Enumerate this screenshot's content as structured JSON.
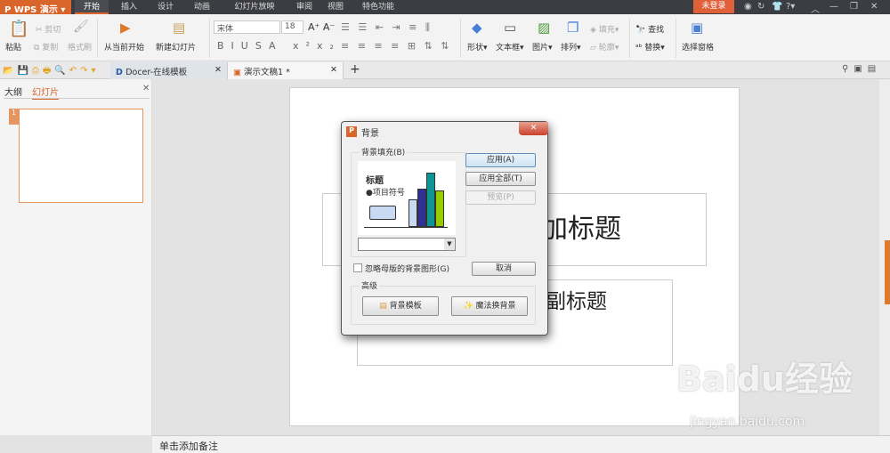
{
  "app": {
    "logo": "WPS 演示",
    "login": "未登录"
  },
  "menu_tabs": [
    "开始",
    "插入",
    "设计",
    "动画",
    "幻灯片放映",
    "审阅",
    "视图",
    "特色功能"
  ],
  "ribbon": {
    "paste": "粘贴",
    "cut": "剪切",
    "copy": "复制",
    "format_painter": "格式刷",
    "from_current": "从当前开始",
    "new_slide": "新建幻灯片",
    "font": "宋体",
    "font_size": "18",
    "shape": "形状",
    "textbox": "文本框",
    "picture": "图片",
    "arrange": "排列",
    "fill": "填充",
    "outline": "轮廓",
    "find": "查找",
    "replace": "替换",
    "selection_pane": "选择窗格"
  },
  "doc_tabs": [
    {
      "label": "Docer-在线模板"
    },
    {
      "label": "演示文稿1 *"
    }
  ],
  "left_pane": {
    "tab_outline": "大纲",
    "tab_slides": "幻灯片",
    "slide_number": "1"
  },
  "slide": {
    "title_placeholder": "单击此处添加标题",
    "subtitle_placeholder": "单击此处添加副标题"
  },
  "notes_placeholder": "单击添加备注",
  "dialog": {
    "title": "背景",
    "fill_group": "背景填充(B)",
    "preview_title": "标题",
    "preview_bullet": "●项目符号",
    "apply": "应用(A)",
    "apply_all": "应用全部(T)",
    "preview": "预览(P)",
    "cancel": "取消",
    "omit_master": "忽略母版的背景图形(G)",
    "omit_master_checked": false,
    "advanced": "高级",
    "bg_template": "背景模板",
    "magic_bg": "魔法换背景",
    "fill_dropdown_value": "",
    "chart_colors": [
      "#c9d9f1",
      "#2e3192",
      "#0f9494",
      "#99cc00"
    ]
  },
  "watermark": {
    "text": "Baidu经验",
    "url_text": "jingyan.baidu.com"
  },
  "colors": {
    "accent": "#d9652b",
    "titlebar": "#3b3d42"
  }
}
